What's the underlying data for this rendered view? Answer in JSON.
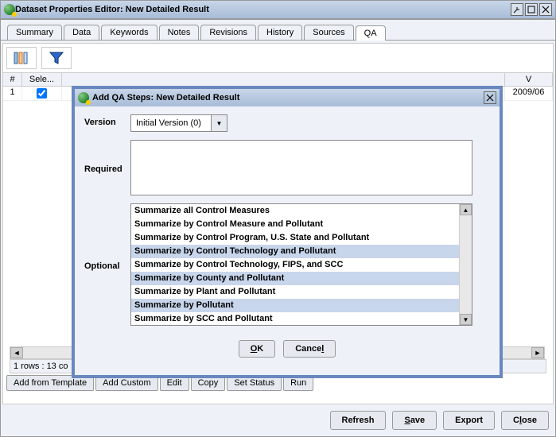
{
  "window": {
    "title": "Dataset Properties Editor: New Detailed Result"
  },
  "tabs": [
    "Summary",
    "Data",
    "Keywords",
    "Notes",
    "Revisions",
    "History",
    "Sources",
    "QA"
  ],
  "activeTab": "QA",
  "grid": {
    "cols": {
      "num": "#",
      "select": "Sele..."
    },
    "row": {
      "num": "1",
      "rightval": "2009/06"
    }
  },
  "statusbar": "1 rows : 13 co",
  "buttons": {
    "addTemplate": "Add from Template",
    "addCustom": "Add Custom",
    "edit": "Edit",
    "copy": "Copy",
    "setStatus": "Set Status",
    "run": "Run",
    "refresh": "Refresh",
    "save": "Save",
    "export": "Export",
    "close": "Close"
  },
  "dialog": {
    "title": "Add QA Steps: New Detailed Result",
    "labels": {
      "version": "Version",
      "required": "Required",
      "optional": "Optional"
    },
    "version": "Initial Version (0)",
    "optional": {
      "items": [
        "Summarize all Control Measures",
        "Summarize by Control Measure and Pollutant",
        "Summarize by Control Program, U.S. State and Pollutant",
        "Summarize by Control Technology and Pollutant",
        "Summarize by Control Technology, FIPS, and SCC",
        "Summarize by County and Pollutant",
        "Summarize by Plant and Pollutant",
        "Summarize by Pollutant",
        "Summarize by SCC and Pollutant"
      ],
      "selected": [
        3,
        5,
        7
      ]
    },
    "buttons": {
      "ok": "OK",
      "cancel": "Cancel"
    }
  }
}
